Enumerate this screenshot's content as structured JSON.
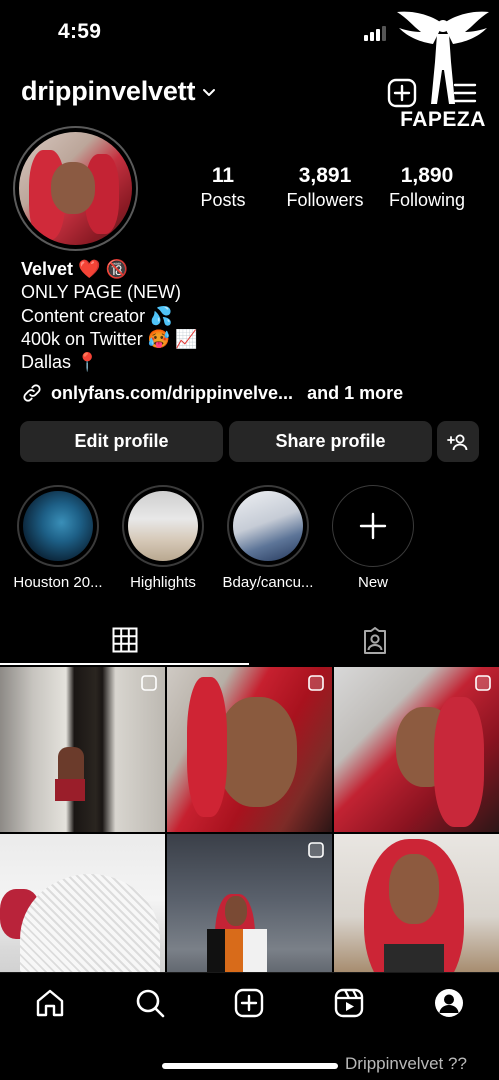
{
  "status_bar": {
    "time": "4:59"
  },
  "watermark": {
    "text": "FAPEZA"
  },
  "header": {
    "username": "drippinvelvett"
  },
  "stats": [
    {
      "value": "11",
      "label": "Posts"
    },
    {
      "value": "3,891",
      "label": "Followers"
    },
    {
      "value": "1,890",
      "label": "Following"
    }
  ],
  "bio": {
    "name": "Velvet ❤️ 🔞",
    "lines": [
      "ONLY PAGE (NEW)",
      "Content creator 💦",
      "400k on Twitter 🥵 📈",
      "Dallas 📍"
    ],
    "link": "onlyfans.com/drippinvelve...",
    "link_more": "and 1 more"
  },
  "buttons": {
    "edit": "Edit profile",
    "share": "Share profile"
  },
  "highlights": [
    {
      "label": "Houston 20..."
    },
    {
      "label": "Highlights"
    },
    {
      "label": "Bday/cancu..."
    },
    {
      "label": "New"
    }
  ],
  "footer_watermark": "Drippinvelvet ??",
  "colors": {
    "background": "#000000",
    "button_bg": "#262626",
    "hair_red": "#c8283a"
  },
  "icons": {
    "create": "plus-square-icon",
    "menu": "hamburger-menu-icon",
    "link": "link-icon",
    "add_person": "add-person-icon",
    "grid": "grid-icon",
    "tagged": "tagged-person-icon",
    "nav": [
      "home-icon",
      "search-icon",
      "create-post-icon",
      "reels-icon",
      "profile-icon"
    ]
  }
}
